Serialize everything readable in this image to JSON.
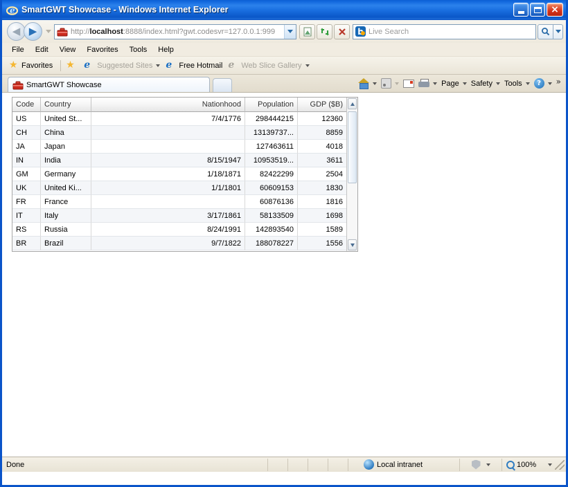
{
  "window": {
    "title": "SmartGWT Showcase - Windows Internet Explorer",
    "icon": "ie-logo-icon",
    "minimize_label": "_",
    "maximize_label": "",
    "close_label": "×"
  },
  "navigation": {
    "back_label": "◀",
    "forward_label": "▶",
    "address": {
      "prefix": "http://",
      "host": "localhost",
      "suffix": ":8888/index.html?gwt.codesvr=127.0.0.1:999",
      "full": "http://localhost:8888/index.html?gwt.codesvr=127.0.0.1:999"
    },
    "buttons": [
      {
        "name": "compatibility-view",
        "glyph": "▤"
      },
      {
        "name": "refresh",
        "glyph": "↻"
      },
      {
        "name": "stop",
        "glyph": "✕"
      }
    ]
  },
  "search": {
    "provider": "b",
    "placeholder": "Live Search",
    "value": "",
    "go_glyph": "⚲"
  },
  "menubar": {
    "items": [
      "File",
      "Edit",
      "View",
      "Favorites",
      "Tools",
      "Help"
    ]
  },
  "favoritesbar": {
    "favorites_label": "Favorites",
    "items": [
      {
        "label": "Suggested Sites",
        "icon": "ie-icon",
        "dimmed": true,
        "has_caret": true
      },
      {
        "label": "Free Hotmail",
        "icon": "ie-icon",
        "dimmed": false,
        "has_caret": false
      },
      {
        "label": "Web Slice Gallery",
        "icon": "ie-icon",
        "dimmed": true,
        "has_caret": true
      }
    ]
  },
  "tabs": {
    "active": {
      "label": "SmartGWT Showcase",
      "icon": "toolbox-icon"
    },
    "new_tab_label": ""
  },
  "commandbar": {
    "items": [
      {
        "name": "home",
        "label": "",
        "icon": "home-icon",
        "caret": true
      },
      {
        "name": "feeds",
        "label": "",
        "icon": "rss-icon",
        "caret": true,
        "dimmed": true
      },
      {
        "name": "read-mail",
        "label": "",
        "icon": "mail-icon",
        "caret": false
      },
      {
        "name": "print",
        "label": "",
        "icon": "printer-icon",
        "caret": true
      },
      {
        "name": "page",
        "label": "Page",
        "icon": "",
        "caret": true
      },
      {
        "name": "safety",
        "label": "Safety",
        "icon": "",
        "caret": true
      },
      {
        "name": "tools",
        "label": "Tools",
        "icon": "",
        "caret": true
      },
      {
        "name": "help",
        "label": "",
        "icon": "help-icon",
        "caret": true
      }
    ],
    "overflow_label": "»"
  },
  "grid": {
    "columns": [
      {
        "key": "code",
        "label": "Code",
        "align": "left"
      },
      {
        "key": "country",
        "label": "Country",
        "align": "left"
      },
      {
        "key": "nationhood",
        "label": "Nationhood",
        "align": "right"
      },
      {
        "key": "population",
        "label": "Population",
        "align": "right"
      },
      {
        "key": "gdp",
        "label": "GDP ($B)",
        "align": "right"
      }
    ],
    "rows": [
      {
        "code": "US",
        "country": "United St...",
        "nationhood": "7/4/1776",
        "population": "298444215",
        "gdp": "12360"
      },
      {
        "code": "CH",
        "country": "China",
        "nationhood": "",
        "population": "13139737...",
        "gdp": "8859"
      },
      {
        "code": "JA",
        "country": "Japan",
        "nationhood": "",
        "population": "127463611",
        "gdp": "4018"
      },
      {
        "code": "IN",
        "country": "India",
        "nationhood": "8/15/1947",
        "population": "10953519...",
        "gdp": "3611"
      },
      {
        "code": "GM",
        "country": "Germany",
        "nationhood": "1/18/1871",
        "population": "82422299",
        "gdp": "2504"
      },
      {
        "code": "UK",
        "country": "United Ki...",
        "nationhood": "1/1/1801",
        "population": "60609153",
        "gdp": "1830"
      },
      {
        "code": "FR",
        "country": "France",
        "nationhood": "",
        "population": "60876136",
        "gdp": "1816"
      },
      {
        "code": "IT",
        "country": "Italy",
        "nationhood": "3/17/1861",
        "population": "58133509",
        "gdp": "1698"
      },
      {
        "code": "RS",
        "country": "Russia",
        "nationhood": "8/24/1991",
        "population": "142893540",
        "gdp": "1589"
      },
      {
        "code": "BR",
        "country": "Brazil",
        "nationhood": "9/7/1822",
        "population": "188078227",
        "gdp": "1556"
      }
    ],
    "scrollbar": {
      "up_glyph": "▲",
      "down_glyph": "▼",
      "thumb_percent": 56
    }
  },
  "statusbar": {
    "message": "Done",
    "zone": "Local intranet",
    "zoom": "100%"
  }
}
